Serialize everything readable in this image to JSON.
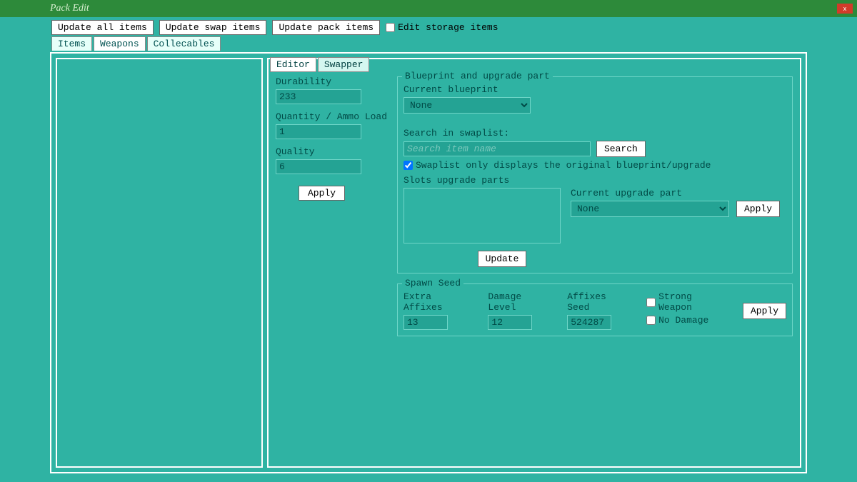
{
  "titlebar": {
    "title": "Pack Edit",
    "close_icon": "x"
  },
  "toolbar": {
    "update_all": "Update all items",
    "update_swap": "Update swap items",
    "update_pack": "Update pack items",
    "edit_storage_label": "Edit storage items",
    "edit_storage_checked": false
  },
  "main_tabs": {
    "items": "Items",
    "weapons": "Weapons",
    "collecables": "Collecables"
  },
  "inner_tabs": {
    "editor": "Editor",
    "swapper": "Swapper"
  },
  "editor": {
    "durability_label": "Durability",
    "durability_value": "233",
    "quantity_label": "Quantity / Ammo Load",
    "quantity_value": "1",
    "quality_label": "Quality",
    "quality_value": "6",
    "apply": "Apply"
  },
  "blueprint": {
    "legend": "Blueprint and upgrade part",
    "current_label": "Current blueprint",
    "current_value": "None",
    "search_label": "Search in swaplist:",
    "search_placeholder": "Search item name",
    "search_btn": "Search",
    "swaplist_only_label": "Swaplist only displays the original blueprint/upgrade",
    "swaplist_only_checked": true,
    "slots_label": "Slots upgrade parts",
    "upgrade_label": "Current upgrade part",
    "upgrade_value": "None",
    "apply": "Apply",
    "update": "Update"
  },
  "spawn": {
    "legend": "Spawn Seed",
    "extra_label": "Extra Affixes",
    "extra_value": "13",
    "damage_label": "Damage Level",
    "damage_value": "12",
    "affixes_label": "Affixes Seed",
    "affixes_value": "524287",
    "strong_label": "Strong Weapon",
    "strong_checked": false,
    "nodmg_label": "No Damage",
    "nodmg_checked": false,
    "apply": "Apply"
  }
}
